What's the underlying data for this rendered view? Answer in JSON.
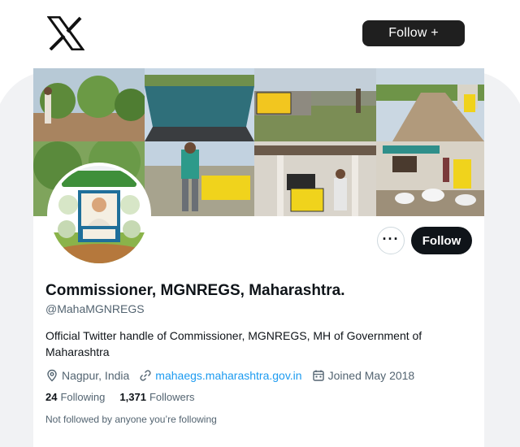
{
  "header": {
    "logo_icon": "x-logo-icon",
    "follow_label": "Follow +"
  },
  "profile": {
    "name": "Commissioner, MGNREGS, Maharashtra.",
    "handle": "@MahaMGNREGS",
    "bio": "Official Twitter handle of Commissioner, MGNREGS, MH of Government of Maharashtra",
    "location": "Nagpur, India",
    "website": "mahaegs.maharashtra.gov.in",
    "joined": "Joined May 2018",
    "following_count": "24",
    "following_label": "Following",
    "followers_count": "1,371",
    "followers_label": "Followers",
    "not_followed": "Not followed by anyone you’re following",
    "follow_button": "Follow",
    "more_icon": "more-options-icon",
    "banner_sign_1": "",
    "banner_sign_2": ""
  },
  "colors": {
    "accent": "#1d9bf0",
    "button_dark": "#0f1419",
    "secondary_text": "#536471"
  }
}
